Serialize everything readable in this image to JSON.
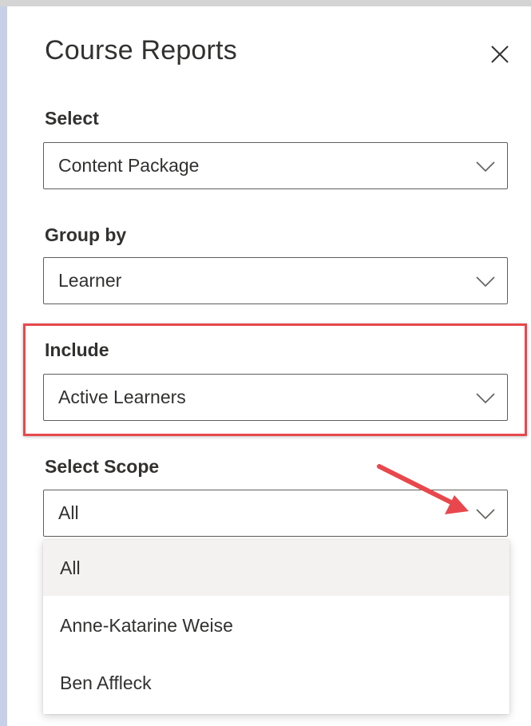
{
  "panel": {
    "title": "Course Reports"
  },
  "fields": {
    "select": {
      "label": "Select",
      "value": "Content Package"
    },
    "group_by": {
      "label": "Group by",
      "value": "Learner"
    },
    "include": {
      "label": "Include",
      "value": "Active Learners"
    },
    "scope": {
      "label": "Select Scope",
      "value": "All"
    }
  },
  "scope_menu": {
    "options": [
      "All",
      "Anne-Katarine Weise",
      "Ben Affleck"
    ],
    "selected": "All"
  },
  "colors": {
    "highlight_border": "#e8484d",
    "annotation_arrow": "#e8484d",
    "selected_option_bg": "#f3f2f1",
    "left_edge": "#c6d0e8"
  },
  "icons": {
    "close": "close-icon",
    "dropdown": "chevron-down-icon",
    "annotation": "arrow-annotation"
  }
}
